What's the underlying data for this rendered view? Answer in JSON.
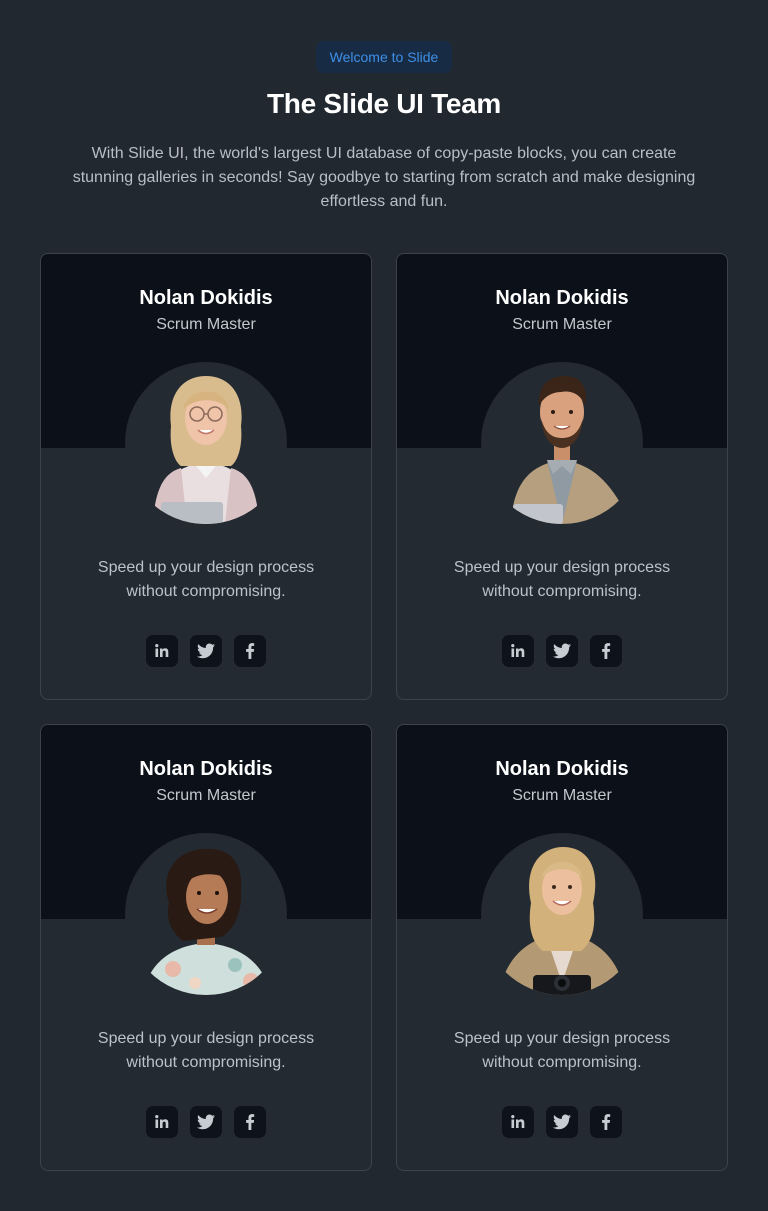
{
  "header": {
    "badge": "Welcome to Slide",
    "title": "The Slide UI Team",
    "subtitle": "With Slide UI, the world's largest UI database of copy-paste blocks, you can create stunning galleries in seconds! Say goodbye to starting from scratch and make designing effortless and fun."
  },
  "team": [
    {
      "name": "Nolan Dokidis",
      "role": "Scrum Master",
      "quote_line1": "Speed up your design process",
      "quote_line2": "without compromising.",
      "photo": "woman-blonde-glasses-laptop"
    },
    {
      "name": "Nolan Dokidis",
      "role": "Scrum Master",
      "quote_line1": "Speed up your design process",
      "quote_line2": "without compromising.",
      "photo": "man-beard-jacket-laptop"
    },
    {
      "name": "Nolan Dokidis",
      "role": "Scrum Master",
      "quote_line1": "Speed up your design process",
      "quote_line2": "without compromising.",
      "photo": "woman-dark-curly-hair"
    },
    {
      "name": "Nolan Dokidis",
      "role": "Scrum Master",
      "quote_line1": "Speed up your design process",
      "quote_line2": "without compromising.",
      "photo": "woman-blonde-camera"
    }
  ],
  "social_icons": [
    "linkedin-icon",
    "twitter-icon",
    "facebook-icon"
  ],
  "colors": {
    "page_bg": "#212830",
    "card_top_bg": "#0c1119",
    "badge_bg": "#172c44",
    "badge_text": "#3f8fe8"
  }
}
